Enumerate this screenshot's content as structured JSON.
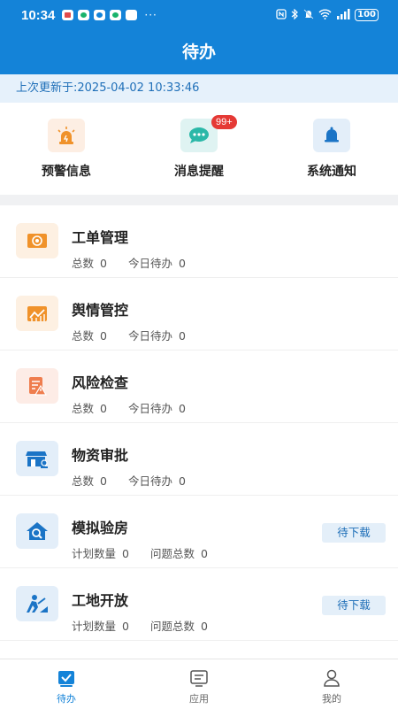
{
  "status_bar": {
    "time": "10:34",
    "more": "···",
    "battery": "100",
    "notification_icons": [
      "red-app-icon",
      "green-app-icon",
      "blue-message-icon",
      "wechat-icon",
      "puzzle-icon"
    ],
    "system_icons": [
      "nfc-icon",
      "bluetooth-icon",
      "mute-icon",
      "wifi-icon",
      "signal-icon",
      "battery-icon"
    ]
  },
  "header": {
    "title": "待办"
  },
  "update_bar": {
    "text": "上次更新于:2025-04-02 10:33:46"
  },
  "quick_actions": [
    {
      "label": "预警信息",
      "icon": "alarm-siren-icon"
    },
    {
      "label": "消息提醒",
      "icon": "chat-bubble-icon",
      "badge": "99+"
    },
    {
      "label": "系统通知",
      "icon": "bell-icon"
    }
  ],
  "tasks": [
    {
      "title": "工单管理",
      "icon": "work-order-icon",
      "stat1_label": "总数",
      "stat1_value": "0",
      "stat2_label": "今日待办",
      "stat2_value": "0"
    },
    {
      "title": "舆情管控",
      "icon": "trend-chart-icon",
      "stat1_label": "总数",
      "stat1_value": "0",
      "stat2_label": "今日待办",
      "stat2_value": "0"
    },
    {
      "title": "风险检查",
      "icon": "risk-document-icon",
      "stat1_label": "总数",
      "stat1_value": "0",
      "stat2_label": "今日待办",
      "stat2_value": "0"
    },
    {
      "title": "物资审批",
      "icon": "store-approval-icon",
      "stat1_label": "总数",
      "stat1_value": "0",
      "stat2_label": "今日待办",
      "stat2_value": "0"
    },
    {
      "title": "模拟验房",
      "icon": "house-inspect-icon",
      "stat1_label": "计划数量",
      "stat1_value": "0",
      "stat2_label": "问题总数",
      "stat2_value": "0",
      "action": "待下载"
    },
    {
      "title": "工地开放",
      "icon": "construction-worker-icon",
      "stat1_label": "计划数量",
      "stat1_value": "0",
      "stat2_label": "问题总数",
      "stat2_value": "0",
      "action": "待下载"
    }
  ],
  "bottom_nav": [
    {
      "label": "待办",
      "icon": "todo-check-icon",
      "active": true
    },
    {
      "label": "应用",
      "icon": "apps-icon",
      "active": false
    },
    {
      "label": "我的",
      "icon": "user-icon",
      "active": false
    }
  ],
  "colors": {
    "brand": "#1483d8",
    "badge": "#e53935",
    "orange_icon": "#f0922a",
    "blue_icon": "#1b74c6"
  }
}
